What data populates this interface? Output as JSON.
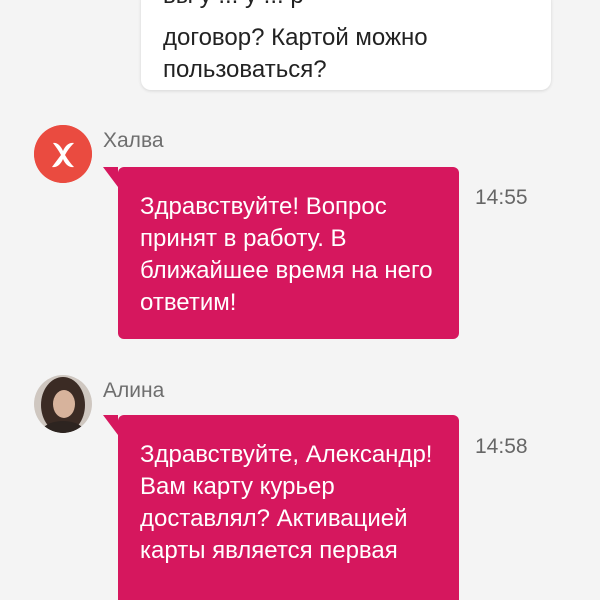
{
  "user_message": {
    "text": "договор? Картой можно пользоваться?"
  },
  "messages": [
    {
      "sender": "Халва",
      "text": "Здравствуйте! Вопрос принят в работу. В ближайшее время на него ответим!",
      "time": "14:55",
      "avatar": "halva-logo-icon"
    },
    {
      "sender": "Алина",
      "text": "Здравствуйте, Александр! Вам карту курьер доставлял? Активацией карты является первая",
      "time": "14:58",
      "avatar": "alina-photo"
    }
  ],
  "colors": {
    "background": "#f4f4f4",
    "bubble_accent": "#d6175e",
    "halva_logo": "#ea4b40"
  }
}
